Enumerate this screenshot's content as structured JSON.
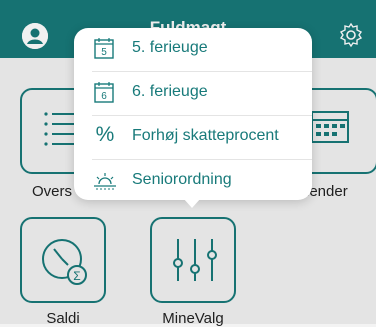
{
  "header": {
    "title": "Fuldmagt"
  },
  "tiles": [
    {
      "label": "Overs"
    },
    {
      "label": "lender"
    },
    {
      "label": "Saldi"
    },
    {
      "label": "MineValg"
    }
  ],
  "menu": {
    "items": [
      {
        "label": "5. ferieuge",
        "icon": "calendar-5-icon",
        "icon_text": "5"
      },
      {
        "label": "6. ferieuge",
        "icon": "calendar-6-icon",
        "icon_text": "6"
      },
      {
        "label": "Forhøj skatteprocent",
        "icon": "percent-icon",
        "icon_text": "%"
      },
      {
        "label": "Seniorordning",
        "icon": "sunset-icon"
      }
    ]
  },
  "colors": {
    "brand": "#187a7a",
    "background": "#f3f3f3"
  }
}
